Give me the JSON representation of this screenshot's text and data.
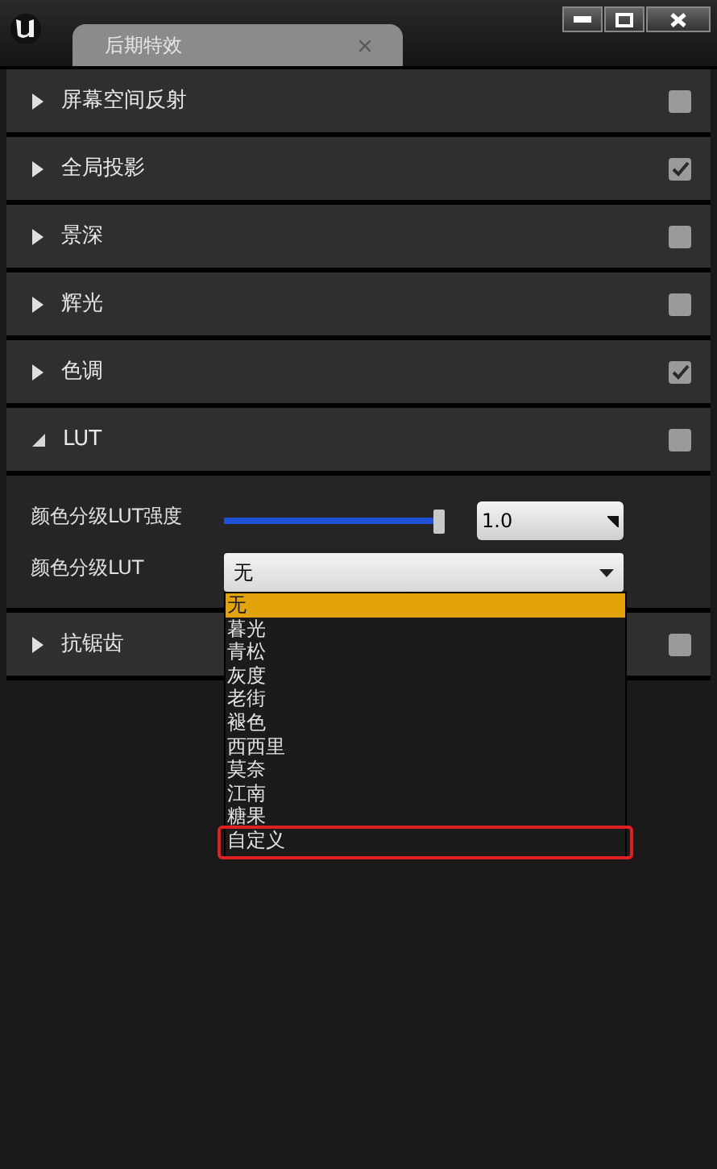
{
  "window": {
    "tab_title": "后期特效"
  },
  "sections": [
    {
      "label": "屏幕空间反射",
      "expanded": false,
      "checked": false
    },
    {
      "label": "全局投影",
      "expanded": false,
      "checked": true
    },
    {
      "label": "景深",
      "expanded": false,
      "checked": false
    },
    {
      "label": "辉光",
      "expanded": false,
      "checked": false
    },
    {
      "label": "色调",
      "expanded": false,
      "checked": true
    },
    {
      "label": "LUT",
      "expanded": true,
      "checked": false,
      "settings": [
        {
          "kind": "slider",
          "label": "颜色分级LUT强度",
          "level": 1.0,
          "value": "1.0"
        },
        {
          "kind": "dropdown",
          "label": "颜色分级LUT",
          "value": "无",
          "open": true,
          "options": [
            {
              "label": "无",
              "selected": true,
              "marked": false
            },
            {
              "label": "暮光",
              "selected": false,
              "marked": false
            },
            {
              "label": "青松",
              "selected": false,
              "marked": false
            },
            {
              "label": "灰度",
              "selected": false,
              "marked": false
            },
            {
              "label": "老街",
              "selected": false,
              "marked": false
            },
            {
              "label": "褪色",
              "selected": false,
              "marked": false
            },
            {
              "label": "西西里",
              "selected": false,
              "marked": false
            },
            {
              "label": "莫奈",
              "selected": false,
              "marked": false
            },
            {
              "label": "江南",
              "selected": false,
              "marked": false
            },
            {
              "label": "糖果",
              "selected": false,
              "marked": false
            },
            {
              "label": "自定义",
              "selected": false,
              "marked": true
            }
          ]
        }
      ]
    },
    {
      "label": "抗锯齿",
      "expanded": false,
      "checked": false
    }
  ]
}
